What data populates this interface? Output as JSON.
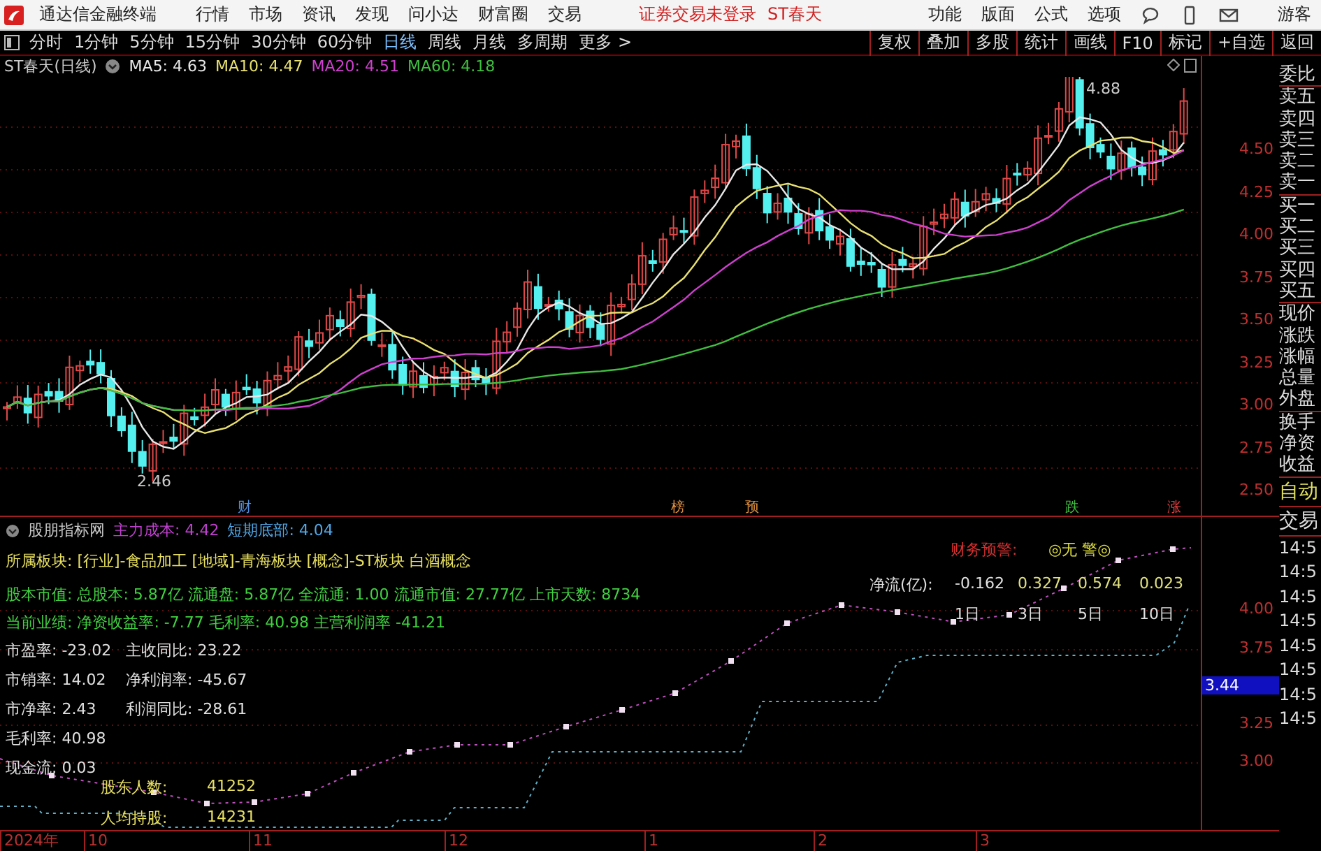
{
  "app": {
    "title": "通达信金融终端",
    "menu": [
      "行情",
      "市场",
      "资讯",
      "发现",
      "问小达",
      "财富圈",
      "交易"
    ],
    "status": [
      "证券交易未登录",
      "ST春天"
    ],
    "right_menu": [
      "功能",
      "版面",
      "公式",
      "选项"
    ],
    "user": "游客"
  },
  "period_tabs": [
    {
      "label": "分时",
      "selected": false
    },
    {
      "label": "1分钟",
      "selected": false
    },
    {
      "label": "5分钟",
      "selected": false
    },
    {
      "label": "15分钟",
      "selected": false
    },
    {
      "label": "30分钟",
      "selected": false
    },
    {
      "label": "60分钟",
      "selected": false
    },
    {
      "label": "日线",
      "selected": true
    },
    {
      "label": "周线",
      "selected": false
    },
    {
      "label": "月线",
      "selected": false
    },
    {
      "label": "多周期",
      "selected": false
    },
    {
      "label": "更多 >",
      "selected": false
    }
  ],
  "tool_buttons": [
    "复权",
    "叠加",
    "多股",
    "统计",
    "画线",
    "F10",
    "标记",
    "+自选",
    "返回"
  ],
  "main_chart": {
    "title": "ST春天(日线)",
    "ma": [
      {
        "label": "MA5: 4.63",
        "color": "#e8e8e8"
      },
      {
        "label": "MA10: 4.47",
        "color": "#e8e070"
      },
      {
        "label": "MA20: 4.51",
        "color": "#d040d0"
      },
      {
        "label": "MA60: 4.18",
        "color": "#40c040"
      }
    ],
    "high_label": "4.88",
    "low_label": "2.46",
    "price_ticks": [
      "4.50",
      "4.25",
      "4.00",
      "3.75",
      "3.50",
      "3.25",
      "3.00",
      "2.75",
      "2.50"
    ],
    "markers": [
      {
        "label": "财",
        "color": "#5090e0"
      },
      {
        "label": "榜",
        "color": "#e09040"
      },
      {
        "label": "预",
        "color": "#e09040"
      },
      {
        "label": "跌",
        "color": "#40c040"
      },
      {
        "label": "涨",
        "color": "#e04040"
      }
    ]
  },
  "indicator": {
    "name": "股朋指标网",
    "cost": "主力成本: 4.42",
    "bottom": "短期底部: 4.04",
    "sector": "所属板块: [行业]-食品加工 [地域]-青海板块 [概念]-ST板块 白酒概念",
    "capital": "股本市值: 总股本: 5.87亿 流通盘: 5.87亿 全流通: 1.00 流通市值: 27.77亿 上市天数: 8734",
    "performance": "当前业绩: 净资收益率: -7.77 毛利率: 40.98 主营利润率 -41.21",
    "ratios_left": [
      "市盈率: -23.02",
      "市销率: 14.02",
      "市净率: 2.43",
      "毛利率: 40.98",
      "现金流: 0.03"
    ],
    "ratios_right": [
      "主收同比: 23.22",
      "净利润率: -45.67",
      "利润同比: -28.61"
    ],
    "holders": [
      {
        "label": "股东人数:",
        "value": "41252"
      },
      {
        "label": "人均持股:",
        "value": "14231"
      }
    ],
    "warning": {
      "label": "财务预警:",
      "value": "◎无 警◎"
    },
    "netflow": {
      "label": "净流(亿):",
      "values": [
        "-0.162",
        "0.327",
        "0.574",
        "0.023"
      ],
      "periods": [
        "1日",
        "3日",
        "5日",
        "10日"
      ]
    },
    "ticks": [
      "4.00",
      "3.75",
      "3.25",
      "3.00"
    ],
    "current": "3.44"
  },
  "time_axis": [
    "2024年",
    "10",
    "11",
    "12",
    "1",
    "2",
    "3"
  ],
  "sidebar": {
    "groups": [
      [
        "委比"
      ],
      [
        "卖五",
        "卖四",
        "卖三",
        "卖二",
        "卖一"
      ],
      [
        "买一",
        "买二",
        "买三",
        "买四",
        "买五"
      ],
      [
        "现价",
        "涨跌",
        "涨幅",
        "总量",
        "外盘"
      ],
      [
        "换手",
        "净资",
        "收益"
      ]
    ],
    "buttons": [
      "自动",
      "交易"
    ],
    "times": [
      "14:5",
      "14:5",
      "14:5",
      "14:5",
      "14:5",
      "14:5",
      "14:5",
      "14:5"
    ]
  }
}
